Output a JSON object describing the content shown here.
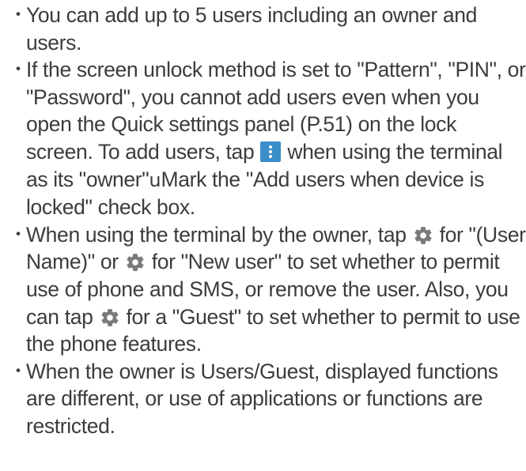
{
  "colors": {
    "text": "#3c3c3c",
    "menu_icon_bg": "#3a8fc8",
    "gear_icon": "#7a7a7a"
  },
  "bullet_char": "・",
  "items": [
    {
      "text": "You can add up to 5 users including an owner and users."
    },
    {
      "part1": "If the screen unlock method is set to \"Pattern\", \"PIN\", or \"Password\", you cannot add users even when you open the Quick settings panel (P.51) on the lock screen. To add users, tap ",
      "icon": "overflow-menu-icon",
      "part2": " when using the terminal as its \"owner\"",
      "arrow": "u",
      "part3": "Mark the \"Add users when device is locked\" check box."
    },
    {
      "part1": "When using the terminal by the owner, tap ",
      "icon1": "gear-icon",
      "part2": " for \"(User Name)\" or ",
      "icon2": "gear-icon",
      "part3": " for \"New user\" to set whether to permit use of phone and SMS, or remove the user. Also, you can tap ",
      "icon3": "gear-icon",
      "part4": " for a \"Guest\" to set whether to permit to use the phone features."
    },
    {
      "text": "When the owner is Users/Guest, displayed functions are different, or use of applications or functions are restricted."
    }
  ]
}
